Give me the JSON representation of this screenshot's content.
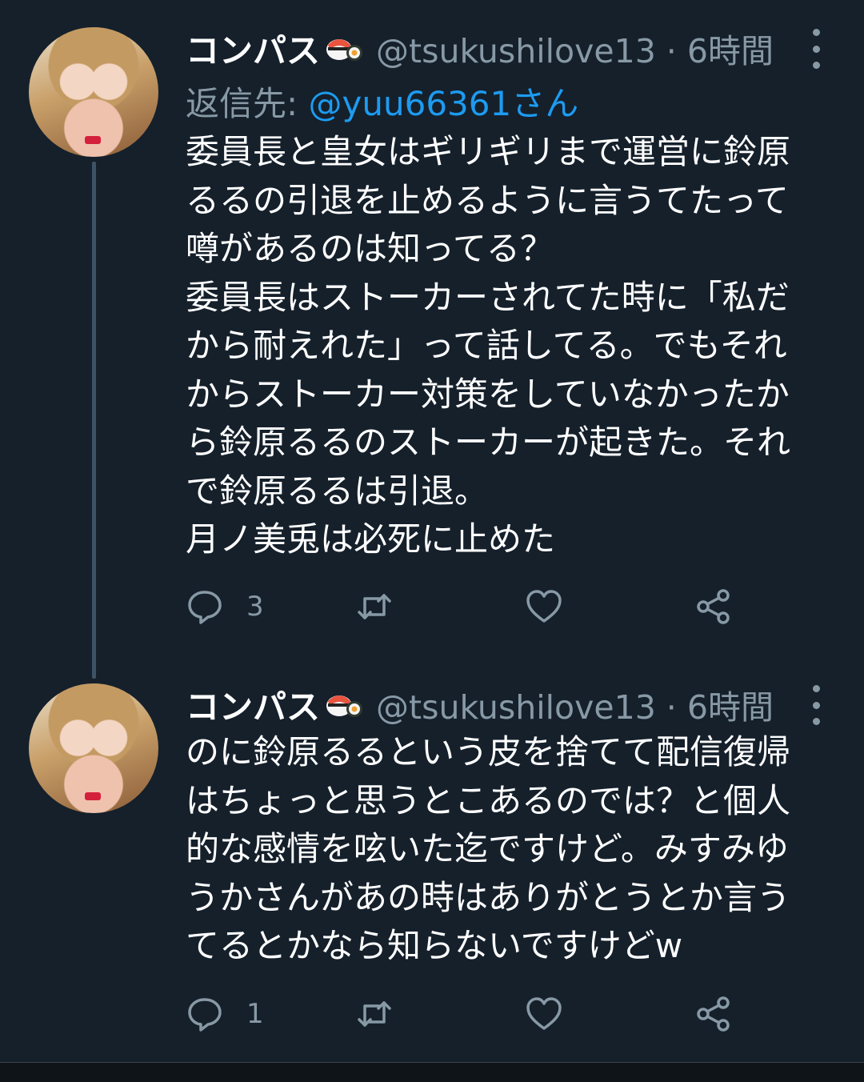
{
  "tweets": [
    {
      "name": "コンパス",
      "name_emoji": "sushi-emoji",
      "meta": "@tsukushilove13 · 6時間",
      "reply_prefix": "返信先: ",
      "reply_handle": "@yuu66361さん",
      "lines": [
        "委員長と皇女はギリギリまで運営に鈴原",
        "るるの引退を止めるように言うてたって",
        "噂があるのは知ってる？",
        "委員長はストーカーされてた時に「私だ",
        "から耐えれた」って話してる。でもそれ",
        "からストーカー対策をしていなかったか",
        "ら鈴原るるのストーカーが起きた。それ",
        "で鈴原るるは引退。",
        "月ノ美兎は必死に止めた"
      ],
      "actions": {
        "reply_count": "3",
        "retweet_count": "",
        "like_count": ""
      }
    },
    {
      "name": "コンパス",
      "name_emoji": "sushi-emoji",
      "meta": "@tsukushilove13 · 6時間",
      "lines": [
        "のに鈴原るるという皮を捨てて配信復帰",
        "はちょっと思うとこあるのでは？と個人",
        "的な感情を呟いた迄ですけど。みすみゆ",
        "うかさんがあの時はありがとうとか言う",
        "てるとかなら知らないですけどw"
      ],
      "actions": {
        "reply_count": "1",
        "retweet_count": "",
        "like_count": ""
      }
    }
  ],
  "colors": {
    "background": "#15202b",
    "text": "#ffffff",
    "secondary": "#8899a6",
    "link": "#1d9bf0",
    "thread_line": "#3d5466"
  }
}
